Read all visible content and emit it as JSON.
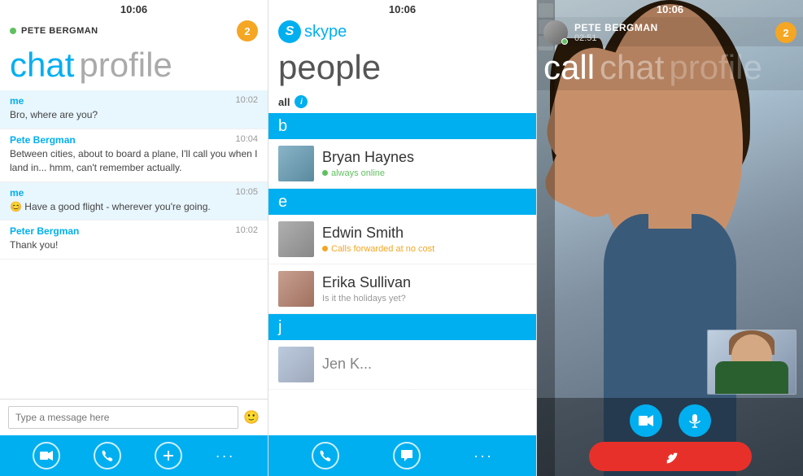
{
  "panel1": {
    "status_bar": "10:06",
    "contact_name": "PETE BERGMAN",
    "badge": "2",
    "title_word1": "chat",
    "title_word2": "profile",
    "messages": [
      {
        "sender": "me",
        "time": "10:02",
        "text": "Bro, where are you?",
        "highlighted": true
      },
      {
        "sender": "Pete Bergman",
        "time": "10:04",
        "text": "Between cities, about to board a plane, I'll call you when I land in... hmm, can't remember actually.",
        "highlighted": false
      },
      {
        "sender": "me",
        "time": "10:05",
        "text": "😊 Have a good flight - wherever you're going.",
        "highlighted": true
      },
      {
        "sender": "Peter Bergman",
        "time": "10:02",
        "text": "Thank you!",
        "highlighted": false
      }
    ],
    "input_placeholder": "Type a message here",
    "bottom_buttons": [
      "video",
      "phone",
      "plus",
      "dots"
    ]
  },
  "panel2": {
    "status_bar": "10:06",
    "skype_label": "skype",
    "page_title": "people",
    "all_label": "all",
    "contacts": [
      {
        "letter_group": "b",
        "name": "Bryan Haynes",
        "status": "always online",
        "status_type": "online"
      },
      {
        "letter_group": "e",
        "name": "Edwin Smith",
        "status": "Calls forwarded at no cost",
        "status_type": "forwarded"
      },
      {
        "letter_group": "",
        "name": "Erika Sullivan",
        "status": "Is it the holidays yet?",
        "status_type": "none"
      },
      {
        "letter_group": "j",
        "name": "Jen K...",
        "status": "",
        "status_type": "none"
      }
    ],
    "bottom_buttons": [
      "phone",
      "chat",
      "dots"
    ]
  },
  "panel3": {
    "status_bar": "10:06",
    "contact_name": "PETE BERGMAN",
    "timer": "02:51",
    "badge": "2",
    "title_call": "call",
    "title_chat": "chat",
    "title_profile": "profile",
    "bottom_video_label": "video",
    "bottom_mic_label": "mic",
    "end_call_label": "end call"
  }
}
